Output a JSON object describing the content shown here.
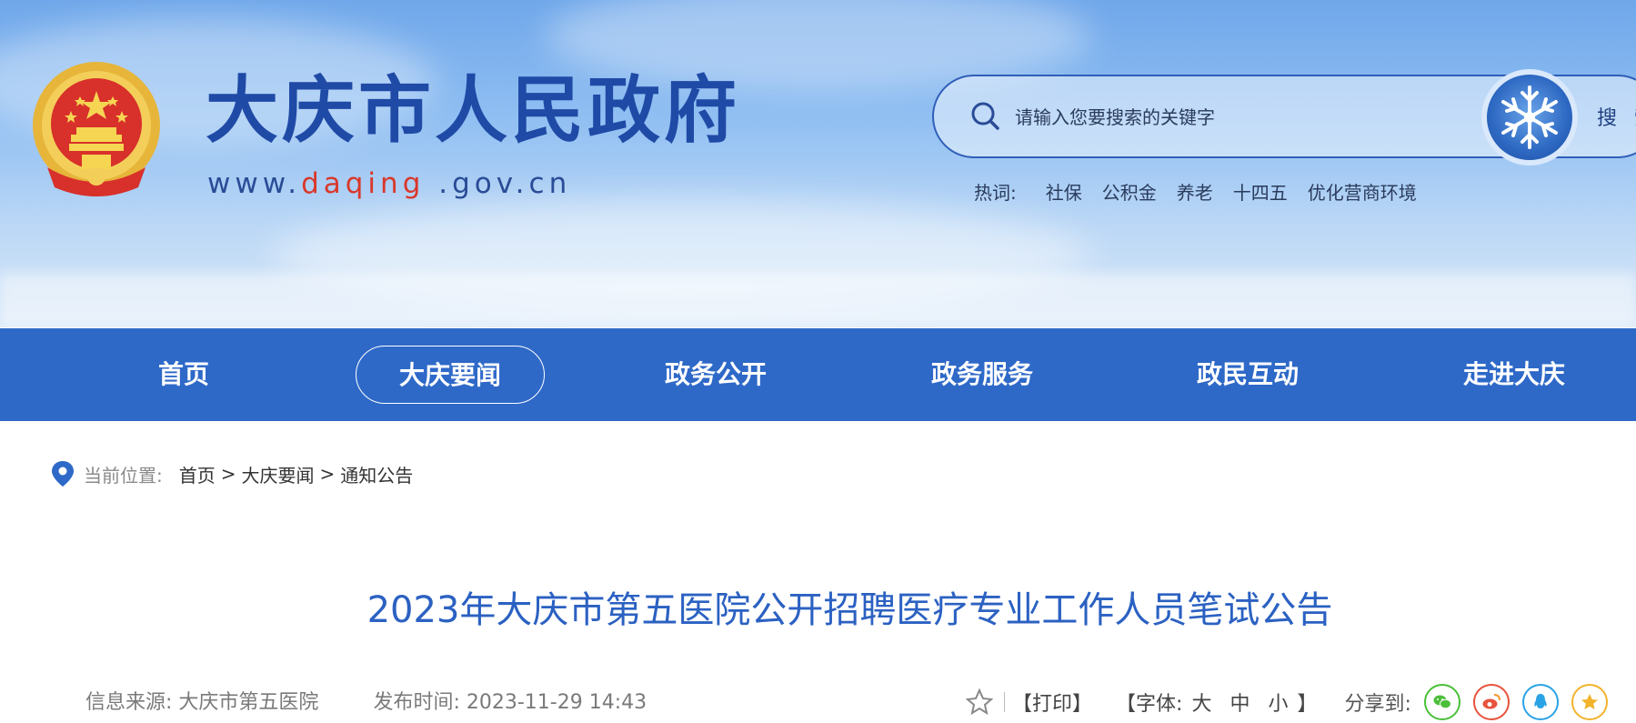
{
  "header": {
    "site_title": "大庆市人民政府",
    "url_prefix": "www.",
    "url_highlight": "daqing",
    "url_suffix": " .gov.cn",
    "search": {
      "placeholder": "请输入您要搜索的关键字",
      "button_label": "搜 索"
    },
    "hotwords": {
      "label": "热词:",
      "items": [
        "社保",
        "公积金",
        "养老",
        "十四五",
        "优化营商环境"
      ]
    }
  },
  "nav": {
    "items": [
      "首页",
      "大庆要闻",
      "政务公开",
      "政务服务",
      "政民互动",
      "走进大庆"
    ],
    "active": "大庆要闻"
  },
  "breadcrumb": {
    "label": "当前位置:",
    "items": [
      "首页",
      "大庆要闻",
      "通知公告"
    ],
    "separator": ">"
  },
  "article": {
    "title": "2023年大庆市第五医院公开招聘医疗专业工作人员笔试公告",
    "source_label": "信息来源:",
    "source": "大庆市第五医院",
    "time_label": "发布时间:",
    "time": "2023-11-29 14:43"
  },
  "tools": {
    "print": "【打印】",
    "font_label": "【字体:",
    "font_sizes": [
      "大",
      "中",
      "小"
    ],
    "font_close": "】",
    "share_label": "分享到:",
    "share_icons": [
      "wechat-icon",
      "weibo-icon",
      "qq-icon",
      "qzone-icon"
    ]
  },
  "colors": {
    "nav_bg": "#2e69c8",
    "title_blue": "#2b61c2",
    "brand_dark": "#1f4aa6",
    "url_red": "#d9382a"
  }
}
